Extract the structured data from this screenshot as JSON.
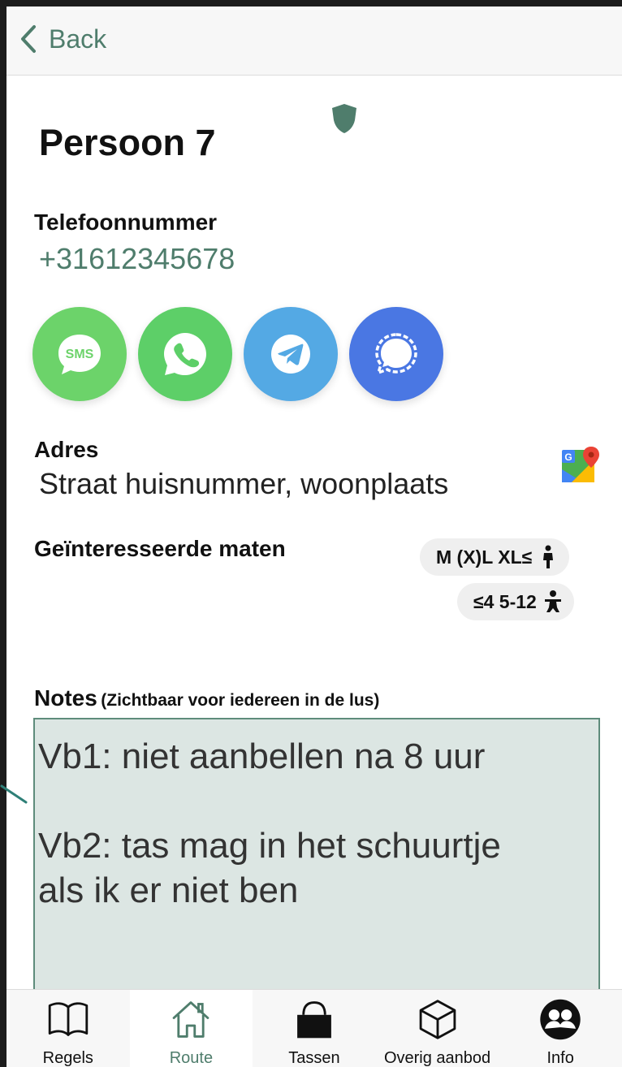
{
  "nav": {
    "back_label": "Back"
  },
  "person": {
    "title": "Persoon 7"
  },
  "phone": {
    "label": "Telefoonnummer",
    "value": "+31612345678"
  },
  "messaging": {
    "sms_label": "SMS",
    "buttons": [
      "sms-icon",
      "whatsapp-icon",
      "telegram-icon",
      "signal-icon"
    ]
  },
  "address": {
    "label": "Adres",
    "value": "Straat huisnummer, woonplaats"
  },
  "sizes": {
    "label": "Geïnteresseerde maten",
    "adult_chip": "M (X)L XL≤",
    "child_chip": "≤4 5-12"
  },
  "notes": {
    "label": "Notes",
    "sublabel": "(Zichtbaar voor iedereen in de lus)",
    "text": "Vb1: niet aanbellen na 8 uur\n\nVb2: tas mag in het schuurtje\nals ik er niet ben"
  },
  "tabs": [
    {
      "label": "Regels"
    },
    {
      "label": "Route",
      "active": true
    },
    {
      "label": "Tassen"
    },
    {
      "label": "Overig aanbod"
    },
    {
      "label": "Info"
    }
  ],
  "colors": {
    "accent": "#4f7d6c",
    "sms": "#6cd36a",
    "whatsapp": "#5dcf68",
    "telegram": "#54a9e4",
    "signal": "#4a77e3",
    "notes_bg": "#dce6e3"
  }
}
